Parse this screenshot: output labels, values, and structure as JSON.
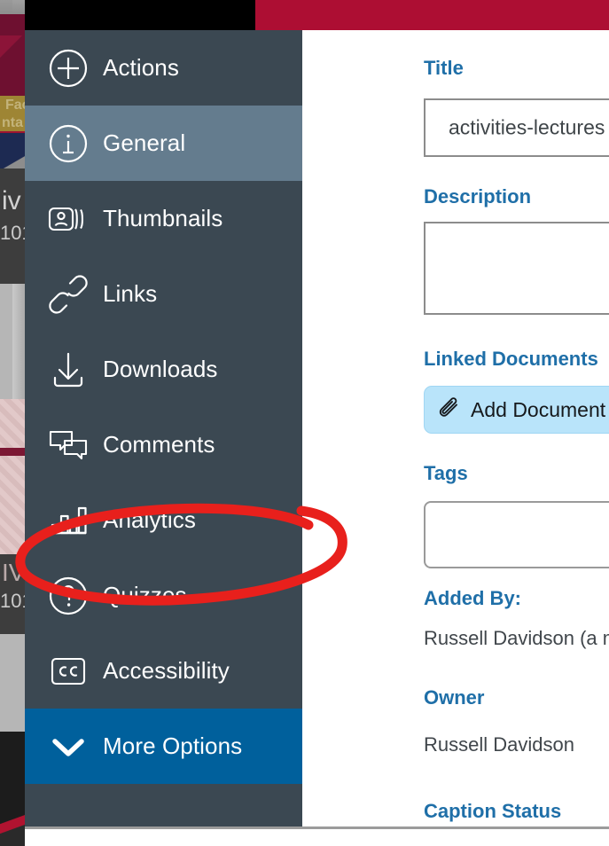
{
  "window": {
    "topbar_left_color": "#000000",
    "topbar_accent_color": "#ad0e33"
  },
  "sidebar": {
    "background_color": "#3b4852",
    "active_item_color": "#647c8e",
    "more_options_color": "#00609c",
    "items": [
      {
        "label": "Actions",
        "icon": "plus-circle-icon",
        "state": "normal"
      },
      {
        "label": "General",
        "icon": "info-circle-icon",
        "state": "selected"
      },
      {
        "label": "Thumbnails",
        "icon": "thumbnails-icon",
        "state": "normal"
      },
      {
        "label": "Links",
        "icon": "link-chain-icon",
        "state": "normal"
      },
      {
        "label": "Downloads",
        "icon": "download-arrow-icon",
        "state": "normal"
      },
      {
        "label": "Comments",
        "icon": "comment-bubbles-icon",
        "state": "normal"
      },
      {
        "label": "Analytics",
        "icon": "bar-chart-icon",
        "state": "normal"
      },
      {
        "label": "Quizzes",
        "icon": "question-circle-icon",
        "state": "normal"
      },
      {
        "label": "Accessibility",
        "icon": "closed-caption-icon",
        "state": "normal"
      },
      {
        "label": "More Options",
        "icon": "chevron-down-icon",
        "state": "highlighted"
      }
    ]
  },
  "form": {
    "accent_color": "#1f6fa8",
    "title": {
      "label": "Title",
      "value": "activities-lectures"
    },
    "description": {
      "label": "Description",
      "value": ""
    },
    "linked_documents": {
      "label": "Linked Documents",
      "button_label": "Add Document",
      "button_icon": "paperclip-icon"
    },
    "tags": {
      "label": "Tags",
      "value": ""
    },
    "added_by": {
      "label": "Added By:",
      "value": "Russell Davidson (a m"
    },
    "owner": {
      "label": "Owner",
      "value": "Russell Davidson"
    },
    "caption_status": {
      "label": "Caption Status"
    }
  },
  "annotation": {
    "shape": "red-ellipse",
    "color": "#e8201c",
    "targets": "Analytics"
  },
  "background_page": {
    "fragments": [
      {
        "text": "Fac",
        "color": "#9a8e5a"
      },
      {
        "text": "nta",
        "color": "#9a8e5a"
      },
      {
        "text": "iv",
        "color": "#cfcfcf"
      },
      {
        "text": "101",
        "color": "#cfcfcf"
      },
      {
        "text": "IV",
        "color": "#b8a8a8"
      },
      {
        "text": "101",
        "color": "#b8a8a8"
      }
    ]
  }
}
